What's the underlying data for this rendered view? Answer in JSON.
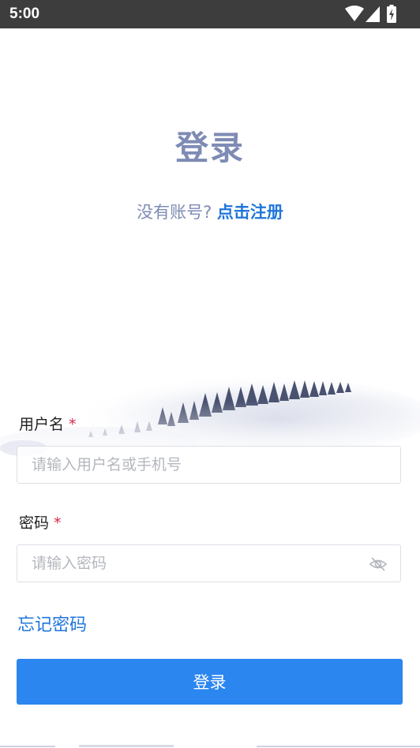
{
  "status_bar": {
    "time": "5:00",
    "icons": [
      "wifi-icon",
      "cellular-signal-icon",
      "battery-charging-icon"
    ]
  },
  "header": {
    "title": "登录",
    "register_prefix": "没有账号? ",
    "register_link": "点击注册"
  },
  "form": {
    "username": {
      "label": "用户名",
      "required_mark": "*",
      "placeholder": "请输入用户名或手机号",
      "value": ""
    },
    "password": {
      "label": "密码",
      "required_mark": "*",
      "placeholder": "请输入密码",
      "value": "",
      "visibility_icon": "eye-off-icon"
    },
    "forgot_password": "忘记密码",
    "submit_label": "登录"
  },
  "colors": {
    "status_bar": "#3d3d3d",
    "title": "#7e8bb4",
    "link": "#1f76db",
    "required": "#d9284b",
    "primary_button": "#2b86f0",
    "input_border": "#dcdfe6",
    "placeholder": "#b4b7be"
  }
}
